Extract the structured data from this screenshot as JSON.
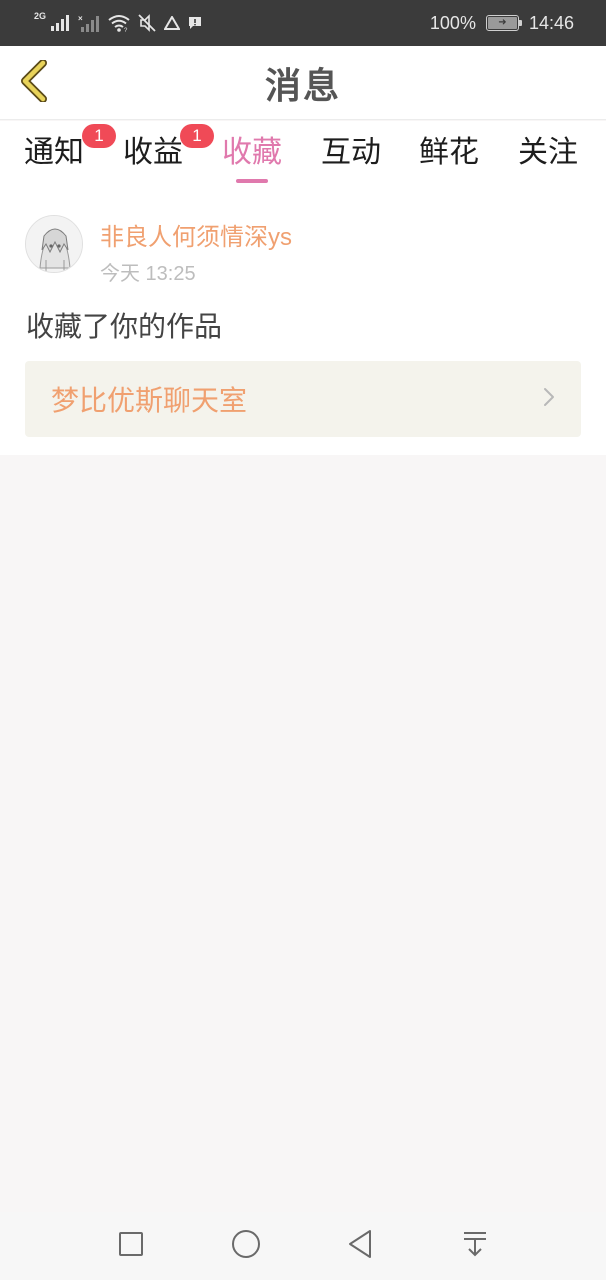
{
  "status_bar": {
    "network_label": "2G",
    "battery": "100%",
    "time": "14:46",
    "icons": [
      "signal-icon",
      "signal-no-sim-icon",
      "wifi-icon",
      "mute-icon",
      "alert-triangle-icon",
      "message-alert-icon",
      "battery-charging-icon"
    ]
  },
  "header": {
    "title": "消息",
    "back_icon": "chevron-left-icon"
  },
  "tabs": [
    {
      "label": "通知",
      "badge": "1",
      "active": false
    },
    {
      "label": "收益",
      "badge": "1",
      "active": false
    },
    {
      "label": "收藏",
      "badge": "",
      "active": true
    },
    {
      "label": "互动",
      "badge": "",
      "active": false
    },
    {
      "label": "鲜花",
      "badge": "",
      "active": false
    },
    {
      "label": "关注",
      "badge": "",
      "active": false
    }
  ],
  "notification": {
    "username": "非良人何须情深ys",
    "timestamp": "今天 13:25",
    "message": "收藏了你的作品",
    "work_title": "梦比优斯聊天室",
    "link_icon": "chevron-right-icon"
  },
  "nav_bar": {
    "icons": [
      "recent-apps-icon",
      "home-icon",
      "back-icon",
      "notification-pulldown-icon"
    ]
  },
  "colors": {
    "accent": "#e079ad",
    "username": "#f0a070",
    "badge": "#f04a57",
    "status_bar_bg": "#3b3b3b",
    "back_arrow": "#e8d35a"
  }
}
